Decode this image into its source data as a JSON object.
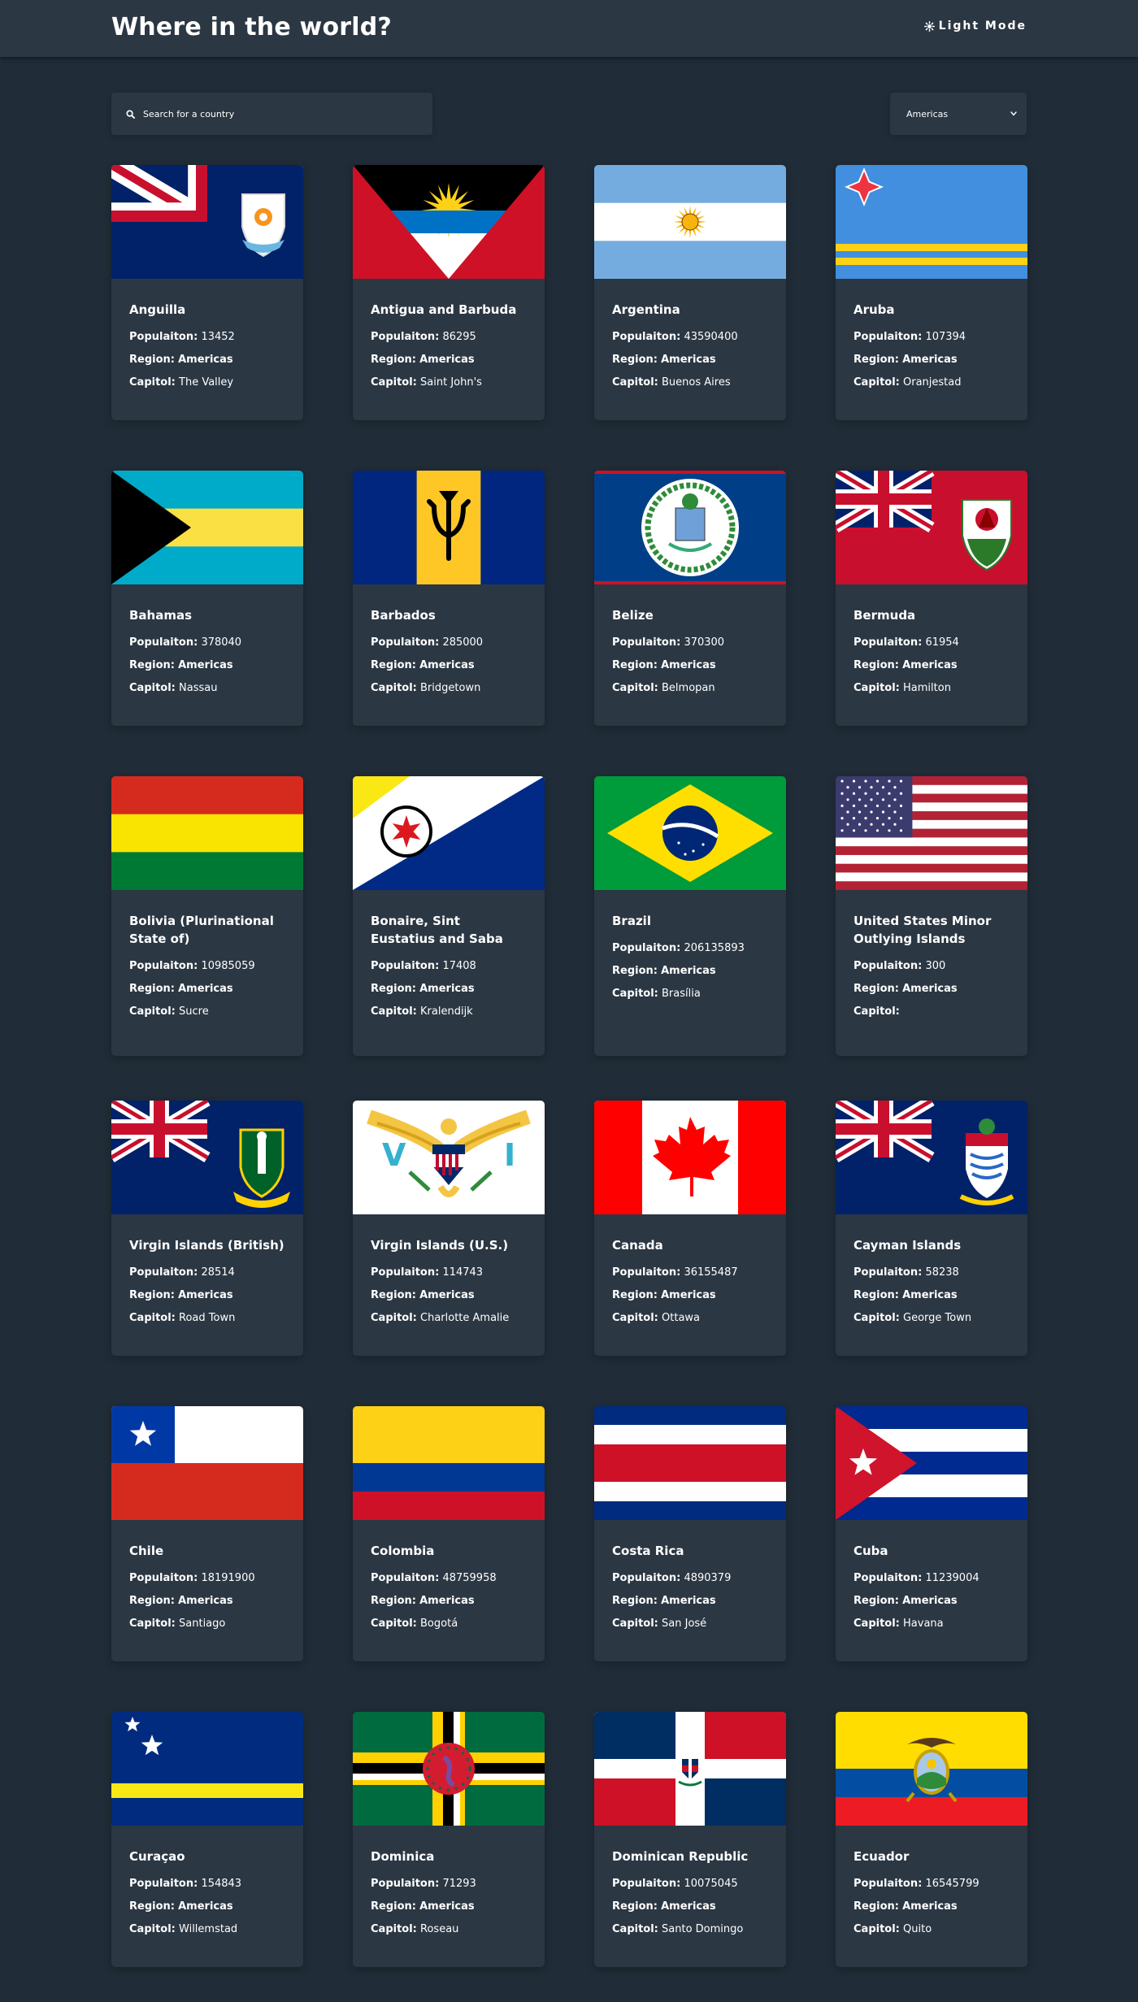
{
  "header": {
    "title": "Where in the world?",
    "mode_label": "Light Mode"
  },
  "search": {
    "placeholder": "Search for a country"
  },
  "filter": {
    "selected": "Americas"
  },
  "labels": {
    "population": "Populaiton:",
    "region": "Region:",
    "capital": "Capitol:"
  },
  "countries": [
    {
      "name": "Anguilla",
      "population": "13452",
      "region": "Americas",
      "capital": "The Valley"
    },
    {
      "name": "Antigua and Barbuda",
      "population": "86295",
      "region": "Americas",
      "capital": "Saint John's"
    },
    {
      "name": "Argentina",
      "population": "43590400",
      "region": "Americas",
      "capital": "Buenos Aires"
    },
    {
      "name": "Aruba",
      "population": "107394",
      "region": "Americas",
      "capital": "Oranjestad"
    },
    {
      "name": "Bahamas",
      "population": "378040",
      "region": "Americas",
      "capital": "Nassau"
    },
    {
      "name": "Barbados",
      "population": "285000",
      "region": "Americas",
      "capital": "Bridgetown"
    },
    {
      "name": "Belize",
      "population": "370300",
      "region": "Americas",
      "capital": "Belmopan"
    },
    {
      "name": "Bermuda",
      "population": "61954",
      "region": "Americas",
      "capital": "Hamilton"
    },
    {
      "name": "Bolivia (Plurinational State of)",
      "population": "10985059",
      "region": "Americas",
      "capital": "Sucre"
    },
    {
      "name": "Bonaire, Sint Eustatius and Saba",
      "population": "17408",
      "region": "Americas",
      "capital": "Kralendijk"
    },
    {
      "name": "Brazil",
      "population": "206135893",
      "region": "Americas",
      "capital": "Brasília"
    },
    {
      "name": "United States Minor Outlying Islands",
      "population": "300",
      "region": "Americas",
      "capital": ""
    },
    {
      "name": "Virgin Islands (British)",
      "population": "28514",
      "region": "Americas",
      "capital": "Road Town"
    },
    {
      "name": "Virgin Islands (U.S.)",
      "population": "114743",
      "region": "Americas",
      "capital": "Charlotte Amalie"
    },
    {
      "name": "Canada",
      "population": "36155487",
      "region": "Americas",
      "capital": "Ottawa"
    },
    {
      "name": "Cayman Islands",
      "population": "58238",
      "region": "Americas",
      "capital": "George Town"
    },
    {
      "name": "Chile",
      "population": "18191900",
      "region": "Americas",
      "capital": "Santiago"
    },
    {
      "name": "Colombia",
      "population": "48759958",
      "region": "Americas",
      "capital": "Bogotá"
    },
    {
      "name": "Costa Rica",
      "population": "4890379",
      "region": "Americas",
      "capital": "San José"
    },
    {
      "name": "Cuba",
      "population": "11239004",
      "region": "Americas",
      "capital": "Havana"
    },
    {
      "name": "Curaçao",
      "population": "154843",
      "region": "Americas",
      "capital": "Willemstad"
    },
    {
      "name": "Dominica",
      "population": "71293",
      "region": "Americas",
      "capital": "Roseau"
    },
    {
      "name": "Dominican Republic",
      "population": "10075045",
      "region": "Americas",
      "capital": "Santo Domingo"
    },
    {
      "name": "Ecuador",
      "population": "16545799",
      "region": "Americas",
      "capital": "Quito"
    }
  ]
}
